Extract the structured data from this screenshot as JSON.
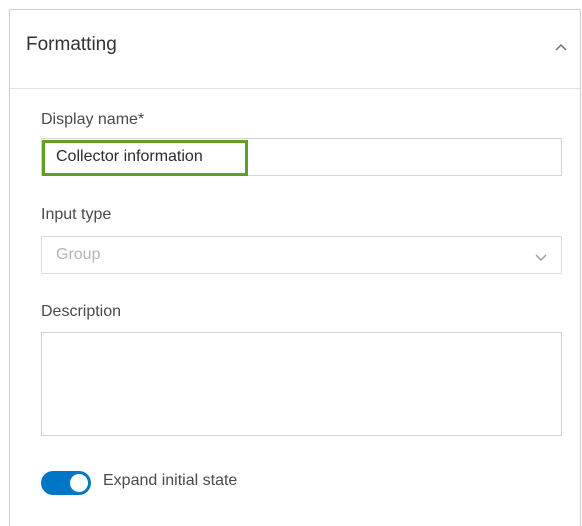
{
  "header": {
    "title": "Formatting"
  },
  "fields": {
    "display_name": {
      "label": "Display name*",
      "value": "Collector information"
    },
    "input_type": {
      "label": "Input type",
      "value": "Group"
    },
    "description": {
      "label": "Description",
      "value": ""
    }
  },
  "toggle": {
    "label": "Expand initial state",
    "state": "on"
  },
  "colors": {
    "accent": "#0076c6",
    "highlight": "#5fa020"
  },
  "icons": {
    "collapse": "chevron-up-icon",
    "dropdown": "chevron-down-icon"
  }
}
